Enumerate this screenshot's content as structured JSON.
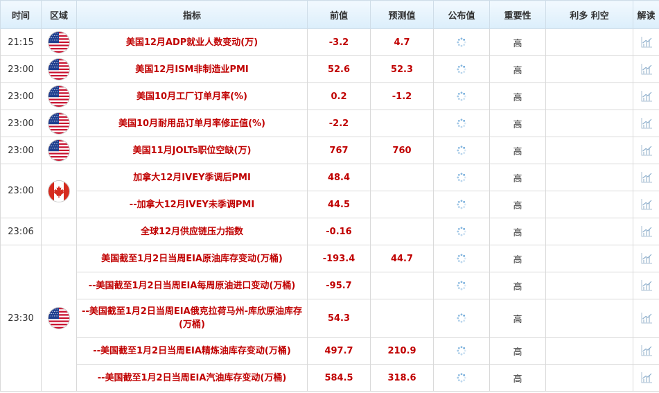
{
  "headers": {
    "time": "时间",
    "region": "区域",
    "indicator": "指标",
    "previous": "前值",
    "forecast": "预测值",
    "actual": "公布值",
    "importance": "重要性",
    "impact": "利多 利空",
    "analysis": "解读"
  },
  "rows": [
    {
      "time": "21:15",
      "flag": "us",
      "indicator": "美国12月ADP就业人数变动(万)",
      "previous": "-3.2",
      "forecast": "4.7",
      "importance": "高"
    },
    {
      "time": "23:00",
      "flag": "us",
      "indicator": "美国12月ISM非制造业PMI",
      "previous": "52.6",
      "forecast": "52.3",
      "importance": "高"
    },
    {
      "time": "23:00",
      "flag": "us",
      "indicator": "美国10月工厂订单月率(%)",
      "previous": "0.2",
      "forecast": "-1.2",
      "importance": "高"
    },
    {
      "time": "23:00",
      "flag": "us",
      "indicator": "美国10月耐用品订单月率修正值(%)",
      "previous": "-2.2",
      "forecast": "",
      "importance": "高"
    },
    {
      "time": "23:00",
      "flag": "us",
      "indicator": "美国11月JOLTs职位空缺(万)",
      "previous": "767",
      "forecast": "760",
      "importance": "高"
    },
    {
      "time": "23:00",
      "flag": "ca",
      "indicator": "加拿大12月IVEY季调后PMI",
      "previous": "48.4",
      "forecast": "",
      "importance": "高"
    },
    {
      "time": "",
      "flag": "",
      "indicator": "--加拿大12月IVEY未季调PMI",
      "previous": "44.5",
      "forecast": "",
      "importance": "高"
    },
    {
      "time": "23:06",
      "flag": "",
      "indicator": "全球12月供应链压力指数",
      "previous": "-0.16",
      "forecast": "",
      "importance": "高"
    },
    {
      "time": "23:30",
      "flag": "us",
      "indicator": "美国截至1月2日当周EIA原油库存变动(万桶)",
      "previous": "-193.4",
      "forecast": "44.7",
      "importance": "高"
    },
    {
      "time": "",
      "flag": "",
      "indicator": "--美国截至1月2日当周EIA每周原油进口变动(万桶)",
      "previous": "-95.7",
      "forecast": "",
      "importance": "高"
    },
    {
      "time": "",
      "flag": "",
      "indicator": "--美国截至1月2日当周EIA俄克拉荷马州-库欣原油库存(万桶)",
      "previous": "54.3",
      "forecast": "",
      "importance": "高"
    },
    {
      "time": "",
      "flag": "",
      "indicator": "--美国截至1月2日当周EIA精炼油库存变动(万桶)",
      "previous": "497.7",
      "forecast": "210.9",
      "importance": "高"
    },
    {
      "time": "",
      "flag": "",
      "indicator": "--美国截至1月2日当周EIA汽油库存变动(万桶)",
      "previous": "584.5",
      "forecast": "318.6",
      "importance": "高"
    }
  ],
  "icons": {
    "us_flag": "us-flag-icon",
    "ca_flag": "canada-flag-icon",
    "pending": "loading-spinner-icon",
    "analysis": "chart-icon"
  },
  "colors": {
    "value_red": "#c00000",
    "header_bg": "#dbeefb",
    "border": "#d9d9d9"
  }
}
